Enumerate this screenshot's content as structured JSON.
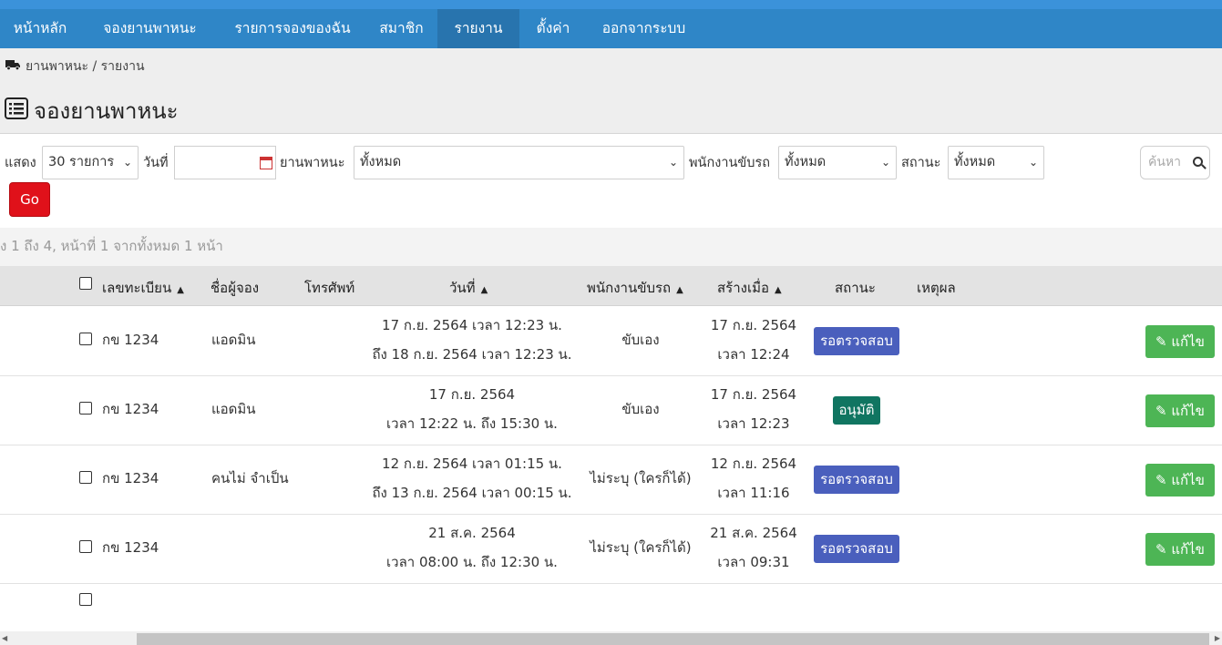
{
  "nav": {
    "items": [
      {
        "label": "หน้าหลัก"
      },
      {
        "label": "จองยานพาหนะ"
      },
      {
        "label": "รายการจองของฉัน"
      },
      {
        "label": "สมาชิก"
      },
      {
        "label": "รายงาน"
      },
      {
        "label": "ตั้งค่า"
      },
      {
        "label": "ออกจากระบบ"
      }
    ],
    "active_index": 4
  },
  "breadcrumb": {
    "text": "ยานพาหนะ / รายงาน"
  },
  "page_title": "จองยานพาหนะ",
  "filters": {
    "show_label": "แสดง",
    "show_value": "30 รายการ",
    "date_label": "วันที่",
    "vehicle_label": "ยานพาหนะ",
    "vehicle_value": "ทั้งหมด",
    "driver_label": "พนักงานขับรถ",
    "driver_value": "ทั้งหมด",
    "status_label": "สถานะ",
    "status_value": "ทั้งหมด",
    "search_placeholder": "ค้นหา",
    "go_label": "Go"
  },
  "info_text": "ง 1 ถึง 4, หน้าที่ 1 จากทั้งหมด 1 หน้า",
  "table": {
    "headers": {
      "plate": "เลขทะเบียน",
      "booker": "ชื่อผู้จอง",
      "phone": "โทรศัพท์",
      "date": "วันที่",
      "driver": "พนักงานขับรถ",
      "created": "สร้างเมื่อ",
      "status": "สถานะ",
      "reason": "เหตุผล"
    },
    "rows": [
      {
        "plate": "กข 1234",
        "booker": "แอดมิน",
        "date_line1": "17 ก.ย. 2564 เวลา 12:23 น.",
        "date_line2": "ถึง 18 ก.ย. 2564 เวลา 12:23 น.",
        "driver": "ขับเอง",
        "created_line1": "17 ก.ย. 2564",
        "created_line2": "เวลา 12:24",
        "status": "รอตรวจสอบ",
        "edit_label": "แก้ไข"
      },
      {
        "plate": "กข 1234",
        "booker": "แอดมิน",
        "date_line1": "17 ก.ย. 2564",
        "date_line2": "เวลา 12:22 น. ถึง 15:30 น.",
        "driver": "ขับเอง",
        "created_line1": "17 ก.ย. 2564",
        "created_line2": "เวลา 12:23",
        "status": "อนุมัติ",
        "edit_label": "แก้ไข"
      },
      {
        "plate": "กข 1234",
        "booker": "คนไม่ จำเป็น",
        "date_line1": "12 ก.ย. 2564 เวลา 01:15 น.",
        "date_line2": "ถึง 13 ก.ย. 2564 เวลา 00:15 น.",
        "driver": "ไม่ระบุ (ใครก็ได้)",
        "created_line1": "12 ก.ย. 2564",
        "created_line2": "เวลา 11:16",
        "status": "รอตรวจสอบ",
        "edit_label": "แก้ไข"
      },
      {
        "plate": "กข 1234",
        "booker": "",
        "date_line1": "21 ส.ค. 2564",
        "date_line2": "เวลา 08:00 น. ถึง 12:30 น.",
        "driver": "ไม่ระบุ (ใครก็ได้)",
        "created_line1": "21 ส.ค. 2564",
        "created_line2": "เวลา 09:31",
        "status": "รอตรวจสอบ",
        "edit_label": "แก้ไข"
      }
    ]
  },
  "colors": {
    "nav": "#2f86c7",
    "pending": "#4a5fbd",
    "approved": "#107561",
    "edit": "#4db555",
    "go": "#e0111a"
  }
}
